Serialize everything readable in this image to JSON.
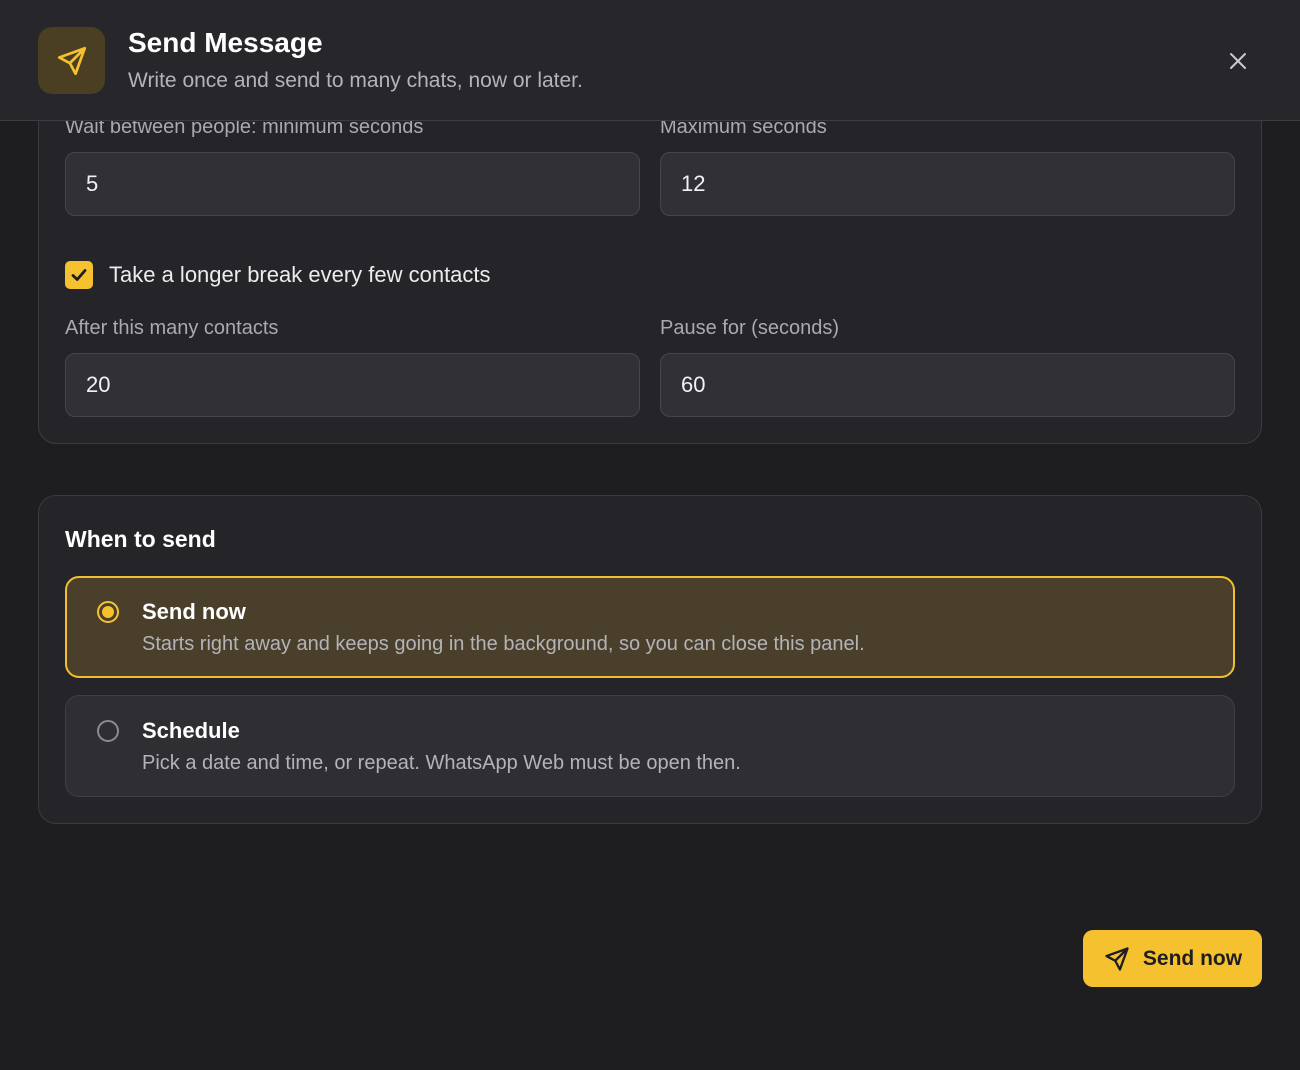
{
  "header": {
    "title": "Send Message",
    "subtitle": "Write once and send to many chats, now or later.",
    "icon": "send-icon",
    "close_icon": "close-icon"
  },
  "pacing": {
    "min_wait_label": "Wait between people: minimum seconds",
    "min_wait_value": "5",
    "max_wait_label": "Maximum seconds",
    "max_wait_value": "12",
    "break_checkbox_label": "Take a longer break every few contacts",
    "break_checked": true,
    "after_contacts_label": "After this many contacts",
    "after_contacts_value": "20",
    "pause_label": "Pause for (seconds)",
    "pause_value": "60"
  },
  "when_to_send": {
    "title": "When to send",
    "options": [
      {
        "title": "Send now",
        "description": "Starts right away and keeps going in the background, so you can close this panel.",
        "selected": true
      },
      {
        "title": "Schedule",
        "description": "Pick a date and time, or repeat. WhatsApp Web must be open then.",
        "selected": false
      }
    ]
  },
  "footer": {
    "send_button_label": "Send now",
    "send_button_icon": "send-icon"
  },
  "colors": {
    "accent": "#f6c12e",
    "background": "#1e1e21",
    "card": "#252529",
    "selected_option_bg": "#4a3f2b"
  }
}
